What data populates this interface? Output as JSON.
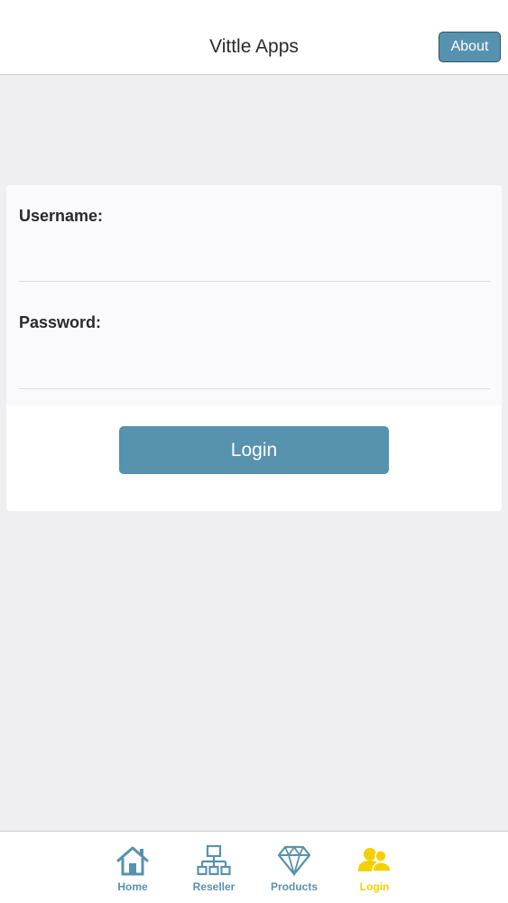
{
  "header": {
    "title": "Vittle Apps",
    "about_label": "About"
  },
  "form": {
    "username_label": "Username:",
    "username_value": "",
    "password_label": "Password:",
    "password_value": "",
    "login_label": "Login"
  },
  "tabs": [
    {
      "label": "Home",
      "icon": "home-icon",
      "active": false
    },
    {
      "label": "Reseller",
      "icon": "network-icon",
      "active": false
    },
    {
      "label": "Products",
      "icon": "diamond-icon",
      "active": false
    },
    {
      "label": "Login",
      "icon": "users-icon",
      "active": true
    }
  ],
  "colors": {
    "accent": "#5792af",
    "active_tab": "#f5d000",
    "background": "#efeef0"
  }
}
